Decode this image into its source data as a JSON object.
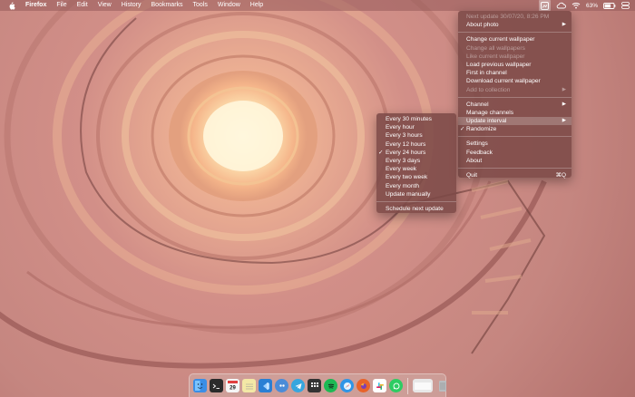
{
  "menubar": {
    "app_name": "Firefox",
    "menus": [
      "File",
      "Edit",
      "View",
      "History",
      "Bookmarks",
      "Tools",
      "Window",
      "Help"
    ],
    "battery_text": "63%",
    "icons": [
      "wallpaper-app-icon",
      "creative-cloud-icon",
      "wifi-icon",
      "battery-icon",
      "control-center-icon"
    ]
  },
  "main_menu": {
    "next_update": "Next update 30/07/20, 8:26 PM",
    "about_photo": "About photo",
    "change_current": "Change current wallpaper",
    "change_all": "Change all wallpapers",
    "like_current": "Like current wallpaper",
    "load_previous": "Load previous wallpaper",
    "first_in_channel": "First in channel",
    "download_current": "Download current wallpaper",
    "add_to_collection": "Add to collection",
    "channel": "Channel",
    "manage_channels": "Manage channels",
    "update_interval": "Update interval",
    "randomize": "Randomize",
    "settings": "Settings",
    "feedback": "Feedback",
    "about": "About",
    "quit": "Quit",
    "quit_shortcut": "⌘Q",
    "check_mark": "✓",
    "arrow": "▶"
  },
  "sub_menu": {
    "items": [
      "Every 30 minutes",
      "Every hour",
      "Every 3 hours",
      "Every 12 hours",
      "Every 24 hours",
      "Every 3 days",
      "Every week",
      "Every two week",
      "Every month",
      "Update manually"
    ],
    "selected": "Every 24 hours",
    "schedule_next": "Schedule next update"
  },
  "dock": {
    "apps": [
      {
        "name": "finder-icon",
        "color": "#3a8ee6"
      },
      {
        "name": "terminal-icon",
        "color": "#2b2b2b"
      },
      {
        "name": "calendar-icon",
        "color": "#f5f5f5"
      },
      {
        "name": "notes-icon",
        "color": "#f3e8a6"
      },
      {
        "name": "vscode-icon",
        "color": "#2a7fd4"
      },
      {
        "name": "tweetbot-icon",
        "color": "#4b8cd8"
      },
      {
        "name": "telegram-icon",
        "color": "#37a6de"
      },
      {
        "name": "app-store-icon",
        "color": "#333333"
      },
      {
        "name": "spotify-icon",
        "color": "#1db954"
      },
      {
        "name": "safari-icon",
        "color": "#2f95e6"
      },
      {
        "name": "firefox-icon",
        "color": "#e8632a"
      },
      {
        "name": "slack-icon",
        "color": "#ffffff"
      },
      {
        "name": "whatsapp-icon",
        "color": "#2dcc63"
      }
    ],
    "extras": [
      {
        "name": "downloads-stack-icon",
        "color": "#e8e8e8"
      },
      {
        "name": "trash-icon",
        "color": "#b9bcbf"
      }
    ]
  }
}
